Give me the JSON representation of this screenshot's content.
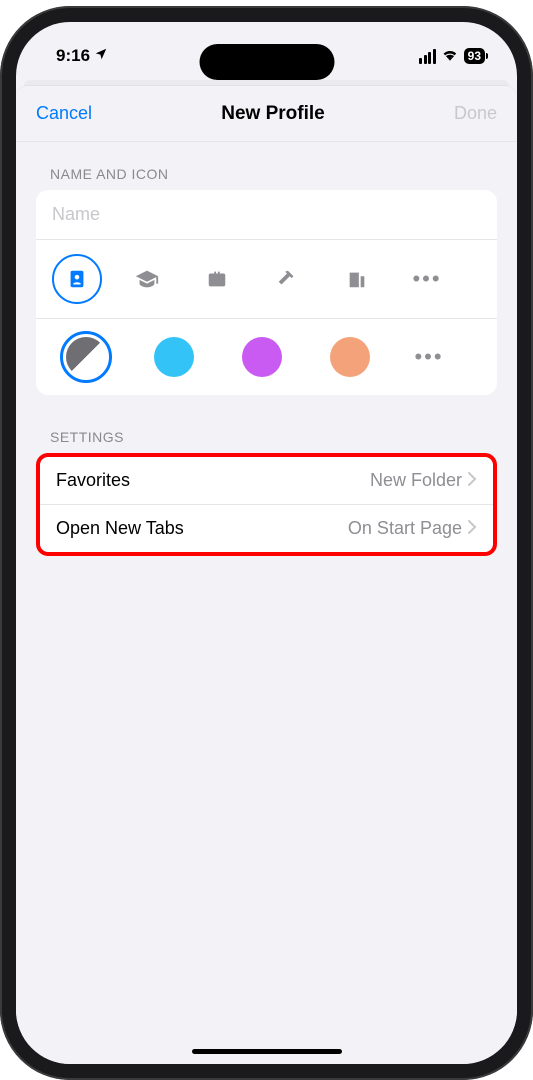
{
  "status": {
    "time": "9:16",
    "battery": "93"
  },
  "nav": {
    "cancel": "Cancel",
    "title": "New Profile",
    "done": "Done"
  },
  "section_name_icon": "NAME AND ICON",
  "name_placeholder": "Name",
  "icons": {
    "selected": "id-card-icon",
    "items": [
      "id-card-icon",
      "graduation-cap-icon",
      "briefcase-icon",
      "hammer-icon",
      "building-icon",
      "more-icon"
    ]
  },
  "colors": {
    "selected_index": 0,
    "items": [
      "#6e6e73/#ffffff",
      "#34c3f7",
      "#c95bf2",
      "#f4a27a",
      "more"
    ]
  },
  "section_settings": "SETTINGS",
  "settings": [
    {
      "label": "Favorites",
      "value": "New Folder"
    },
    {
      "label": "Open New Tabs",
      "value": "On Start Page"
    }
  ]
}
